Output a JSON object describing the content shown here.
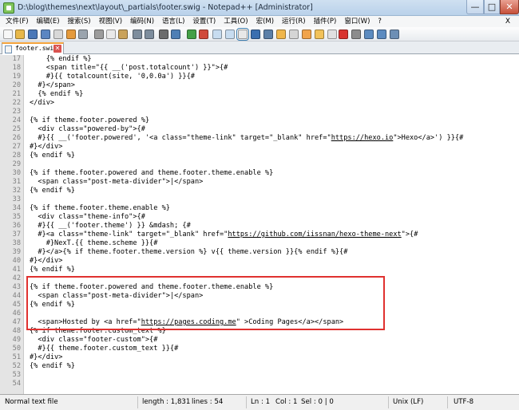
{
  "window": {
    "title": "D:\\blog\\themes\\next\\layout\\_partials\\footer.swig - Notepad++ [Administrator]",
    "min_glyph": "—",
    "max_glyph": "□",
    "close_glyph": "✕"
  },
  "menu": {
    "items": [
      "文件(F)",
      "编辑(E)",
      "搜索(S)",
      "视图(V)",
      "编码(N)",
      "语言(L)",
      "设置(T)",
      "工具(O)",
      "宏(M)",
      "运行(R)",
      "插件(P)",
      "窗口(W)",
      "?"
    ],
    "close_x": "X"
  },
  "toolbar": {
    "icons": [
      {
        "name": "new-file-icon",
        "color": "#f7f7f7"
      },
      {
        "name": "open-file-icon",
        "color": "#e8b84a"
      },
      {
        "name": "save-icon",
        "color": "#4a78b8"
      },
      {
        "name": "save-all-icon",
        "color": "#5b86c2"
      },
      {
        "name": "close-file-icon",
        "color": "#d8d8d8"
      },
      {
        "name": "close-all-icon",
        "color": "#e59a3c"
      },
      {
        "name": "print-icon",
        "color": "#9aa4ae"
      },
      {
        "name": "cut-icon",
        "color": "#9c9c9c"
      },
      {
        "name": "copy-icon",
        "color": "#e9e9e9"
      },
      {
        "name": "paste-icon",
        "color": "#c9a25a"
      },
      {
        "name": "undo-icon",
        "color": "#7d8d9d"
      },
      {
        "name": "redo-icon",
        "color": "#7d8d9d"
      },
      {
        "name": "find-icon",
        "color": "#6c6c6c"
      },
      {
        "name": "replace-icon",
        "color": "#4e7fb5"
      },
      {
        "name": "zoom-in-icon",
        "color": "#44a047"
      },
      {
        "name": "zoom-out-icon",
        "color": "#d04a3a"
      },
      {
        "name": "sync-vertical-icon",
        "color": "#c7dcf0"
      },
      {
        "name": "sync-horizontal-icon",
        "color": "#c7dcf0"
      },
      {
        "name": "word-wrap-icon",
        "color": "#e8e8e8"
      },
      {
        "name": "show-all-chars-icon",
        "color": "#3b6fb0"
      },
      {
        "name": "indent-guide-icon",
        "color": "#5b7fa8"
      },
      {
        "name": "user-language-icon",
        "color": "#f0b64a"
      },
      {
        "name": "doc-map-icon",
        "color": "#d5d5d5"
      },
      {
        "name": "function-list-icon",
        "color": "#f1a34a"
      },
      {
        "name": "folder-workspace-icon",
        "color": "#f2c25a"
      },
      {
        "name": "monitoring-icon",
        "color": "#e0e0e0"
      },
      {
        "name": "record-macro-icon",
        "color": "#d9332f"
      },
      {
        "name": "stop-macro-icon",
        "color": "#8c8c8c"
      },
      {
        "name": "play-macro-icon",
        "color": "#5c8bc0"
      },
      {
        "name": "play-multiple-macro-icon",
        "color": "#5c8bc0"
      },
      {
        "name": "save-macro-icon",
        "color": "#6d8fb5"
      }
    ]
  },
  "tab": {
    "label": "footer.swig",
    "close_glyph": "✕"
  },
  "editor": {
    "lines": [
      {
        "no": "17",
        "text": "    {% endif %}"
      },
      {
        "no": "18",
        "text": "    <span title=\"{{ __('post.totalcount') }}\">{#"
      },
      {
        "no": "19",
        "text": "    #}{{ totalcount(site, '0,0.0a') }}{#"
      },
      {
        "no": "20",
        "text": "  #}</span>"
      },
      {
        "no": "21",
        "text": "  {% endif %}"
      },
      {
        "no": "22",
        "text": "</div>"
      },
      {
        "no": "23",
        "text": ""
      },
      {
        "no": "24",
        "text": "{% if theme.footer.powered %}"
      },
      {
        "no": "25",
        "text": "  <div class=\"powered-by\">{#"
      },
      {
        "no": "26",
        "pre": "  #}{{ __('footer.powered', '<a class=\"theme-link\" target=\"_blank\" href=\"",
        "link": "https://hexo.io",
        "post": "\">Hexo</a>') }}{#"
      },
      {
        "no": "27",
        "text": "#}</div>"
      },
      {
        "no": "28",
        "text": "{% endif %}"
      },
      {
        "no": "29",
        "text": ""
      },
      {
        "no": "30",
        "text": "{% if theme.footer.powered and theme.footer.theme.enable %}"
      },
      {
        "no": "31",
        "text": "  <span class=\"post-meta-divider\">|</span>"
      },
      {
        "no": "32",
        "text": "{% endif %}"
      },
      {
        "no": "33",
        "text": ""
      },
      {
        "no": "34",
        "text": "{% if theme.footer.theme.enable %}"
      },
      {
        "no": "35",
        "text": "  <div class=\"theme-info\">{#"
      },
      {
        "no": "36",
        "text": "  #}{{ __('footer.theme') }} &mdash; {#"
      },
      {
        "no": "37",
        "pre": "  #}<a class=\"theme-link\" target=\"_blank\" href=\"",
        "link": "https://github.com/iissnan/hexo-theme-next",
        "post": "\">{#"
      },
      {
        "no": "38",
        "text": "    #}NexT.{{ theme.scheme }}{#"
      },
      {
        "no": "39",
        "text": "  #}</a>{% if theme.footer.theme.version %} v{{ theme.version }}{% endif %}{#"
      },
      {
        "no": "40",
        "text": "#}</div>"
      },
      {
        "no": "41",
        "text": "{% endif %}"
      },
      {
        "no": "42",
        "text": ""
      },
      {
        "no": "43",
        "text": "{% if theme.footer.powered and theme.footer.theme.enable %}"
      },
      {
        "no": "44",
        "text": "  <span class=\"post-meta-divider\">|</span>"
      },
      {
        "no": "45",
        "text": "{% endif %}"
      },
      {
        "no": "46",
        "text": ""
      },
      {
        "no": "47",
        "pre": "  <span>Hosted by <a href=\"",
        "link": "https://pages.coding.me",
        "post": "\" >Coding Pages</a></span>"
      },
      {
        "no": "48",
        "text": "{% if theme.footer.custom_text %}"
      },
      {
        "no": "49",
        "text": "  <div class=\"footer-custom\">{#"
      },
      {
        "no": "50",
        "text": "  #}{{ theme.footer.custom_text }}{#"
      },
      {
        "no": "51",
        "text": "#}</div>"
      },
      {
        "no": "52",
        "text": "{% endif %}"
      },
      {
        "no": "53",
        "text": ""
      },
      {
        "no": "54",
        "text": ""
      }
    ],
    "highlight_color": "#e0312f"
  },
  "status": {
    "mode": "Normal text file",
    "length": "length : 1,831",
    "lines": "lines : 54",
    "ln": "Ln : 1",
    "col": "Col : 1",
    "sel": "Sel : 0 | 0",
    "eol": "Unix (LF)",
    "encoding": "UTF-8"
  }
}
